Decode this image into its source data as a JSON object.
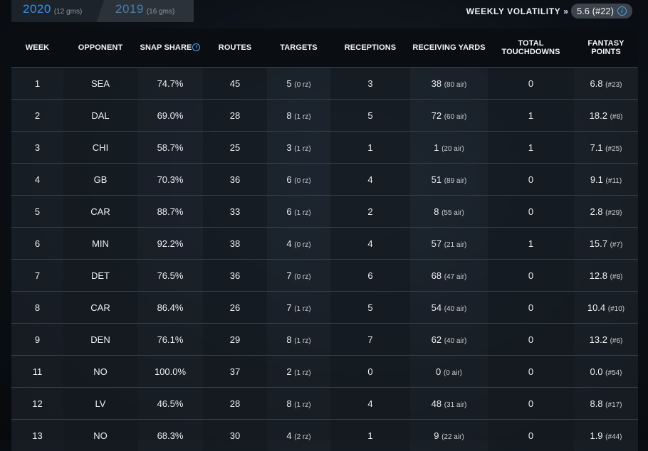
{
  "seasons": [
    {
      "year": "2020",
      "games": "(12 gms)"
    },
    {
      "year": "2019",
      "games": "(16 gms)"
    }
  ],
  "volatility": {
    "label": "WEEKLY VOLATILITY",
    "arrow": "»",
    "value": "5.6 (#22)"
  },
  "columns": [
    "WEEK",
    "OPPONENT",
    "SNAP SHARE",
    "ROUTES",
    "TARGETS",
    "RECEPTIONS",
    "RECEIVING YARDS",
    "TOTAL TOUCHDOWNS",
    "FANTASY POINTS"
  ],
  "rows": [
    {
      "week": "1",
      "opp": "SEA",
      "snap": "74.7%",
      "routes": "45",
      "targets": "5",
      "targets_rz": "(0 rz)",
      "rec": "3",
      "yards": "38",
      "yards_air": "(80 air)",
      "td": "0",
      "fp": "6.8",
      "fp_rank": "(#23)"
    },
    {
      "week": "2",
      "opp": "DAL",
      "snap": "69.0%",
      "routes": "28",
      "targets": "8",
      "targets_rz": "(1 rz)",
      "rec": "5",
      "yards": "72",
      "yards_air": "(60 air)",
      "td": "1",
      "fp": "18.2",
      "fp_rank": "(#8)"
    },
    {
      "week": "3",
      "opp": "CHI",
      "snap": "58.7%",
      "routes": "25",
      "targets": "3",
      "targets_rz": "(1 rz)",
      "rec": "1",
      "yards": "1",
      "yards_air": "(20 air)",
      "td": "1",
      "fp": "7.1",
      "fp_rank": "(#25)"
    },
    {
      "week": "4",
      "opp": "GB",
      "snap": "70.3%",
      "routes": "36",
      "targets": "6",
      "targets_rz": "(0 rz)",
      "rec": "4",
      "yards": "51",
      "yards_air": "(89 air)",
      "td": "0",
      "fp": "9.1",
      "fp_rank": "(#11)"
    },
    {
      "week": "5",
      "opp": "CAR",
      "snap": "88.7%",
      "routes": "33",
      "targets": "6",
      "targets_rz": "(1 rz)",
      "rec": "2",
      "yards": "8",
      "yards_air": "(55 air)",
      "td": "0",
      "fp": "2.8",
      "fp_rank": "(#29)"
    },
    {
      "week": "6",
      "opp": "MIN",
      "snap": "92.2%",
      "routes": "38",
      "targets": "4",
      "targets_rz": "(0 rz)",
      "rec": "4",
      "yards": "57",
      "yards_air": "(21 air)",
      "td": "1",
      "fp": "15.7",
      "fp_rank": "(#7)"
    },
    {
      "week": "7",
      "opp": "DET",
      "snap": "76.5%",
      "routes": "36",
      "targets": "7",
      "targets_rz": "(0 rz)",
      "rec": "6",
      "yards": "68",
      "yards_air": "(47 air)",
      "td": "0",
      "fp": "12.8",
      "fp_rank": "(#8)"
    },
    {
      "week": "8",
      "opp": "CAR",
      "snap": "86.4%",
      "routes": "26",
      "targets": "7",
      "targets_rz": "(1 rz)",
      "rec": "5",
      "yards": "54",
      "yards_air": "(40 air)",
      "td": "0",
      "fp": "10.4",
      "fp_rank": "(#10)"
    },
    {
      "week": "9",
      "opp": "DEN",
      "snap": "76.1%",
      "routes": "29",
      "targets": "8",
      "targets_rz": "(1 rz)",
      "rec": "7",
      "yards": "62",
      "yards_air": "(40 air)",
      "td": "0",
      "fp": "13.2",
      "fp_rank": "(#6)"
    },
    {
      "week": "11",
      "opp": "NO",
      "snap": "100.0%",
      "routes": "37",
      "targets": "2",
      "targets_rz": "(1 rz)",
      "rec": "0",
      "yards": "0",
      "yards_air": "(0 air)",
      "td": "0",
      "fp": "0.0",
      "fp_rank": "(#54)"
    },
    {
      "week": "12",
      "opp": "LV",
      "snap": "46.5%",
      "routes": "28",
      "targets": "8",
      "targets_rz": "(1 rz)",
      "rec": "4",
      "yards": "48",
      "yards_air": "(31 air)",
      "td": "0",
      "fp": "8.8",
      "fp_rank": "(#17)"
    },
    {
      "week": "13",
      "opp": "NO",
      "snap": "68.3%",
      "routes": "30",
      "targets": "4",
      "targets_rz": "(2 rz)",
      "rec": "1",
      "yards": "9",
      "yards_air": "(22 air)",
      "td": "0",
      "fp": "1.9",
      "fp_rank": "(#44)"
    }
  ],
  "colors": {
    "accent": "#3f8fd9",
    "info": "#4aa6ff"
  },
  "icons": {
    "info": "info-icon"
  }
}
